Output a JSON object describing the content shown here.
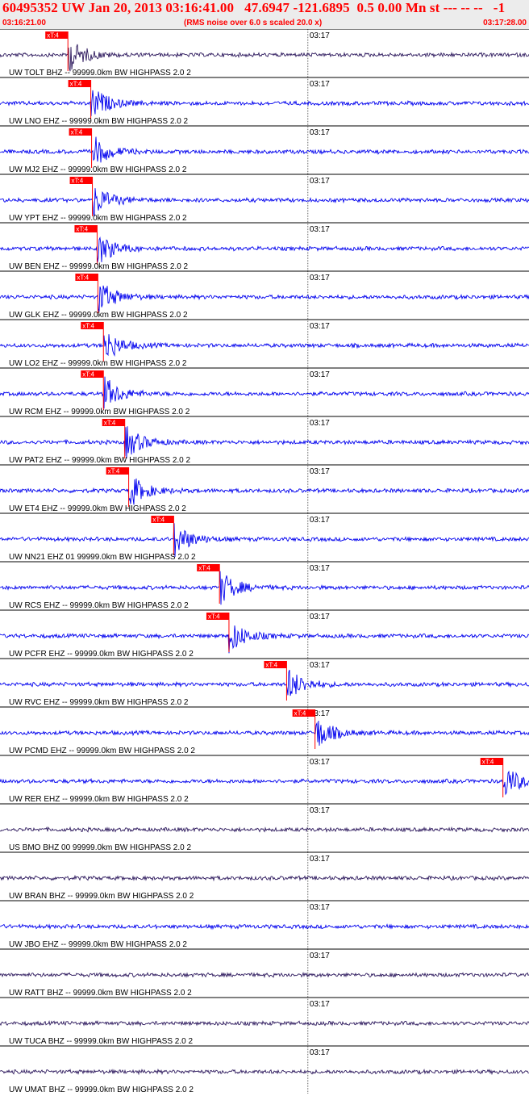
{
  "header": {
    "title": "60495352 UW Jan 20, 2013 03:16:41.00   47.6947 -121.6895  0.5 0.00 Mn st --- -- --   -1",
    "start_time": "03:16:21.00",
    "rms_note": "(RMS noise over 6.0 s scaled 20.0 x)",
    "end_time": "03:17:28.00"
  },
  "colors": {
    "header_text": "#ff0000",
    "header_bg": "#ececec",
    "trace_blue": "#0000ee",
    "trace_dark": "#2e1a5e",
    "pick_box": "#ff0000",
    "pick_text": "#ffffff",
    "label_text": "#000000"
  },
  "chart_data": {
    "type": "line",
    "time_axis": {
      "start": "03:16:21.00",
      "end": "03:17:28.00",
      "minute_mark": "03:17"
    },
    "pick_label": "xT:4",
    "traces": [
      {
        "label": "UW TOLT BHZ -- 99999.0km BW  HIGHPASS  2.0  2",
        "color": "dark",
        "pick": true,
        "pick_time": "03:16:29.6"
      },
      {
        "label": "UW LNO EHZ -- 99999.0km BW  HIGHPASS  2.0  2",
        "color": "blue",
        "pick": true,
        "pick_time": "03:16:32.5"
      },
      {
        "label": "UW MJ2 EHZ -- 99999.0km BW  HIGHPASS  2.0  2",
        "color": "blue",
        "pick": true,
        "pick_time": "03:16:32.6"
      },
      {
        "label": "UW YPT EHZ -- 99999.0km BW  HIGHPASS  2.0  2",
        "color": "blue",
        "pick": true,
        "pick_time": "03:16:32.7"
      },
      {
        "label": "UW BEN EHZ -- 99999.0km BW  HIGHPASS  2.0  2",
        "color": "blue",
        "pick": true,
        "pick_time": "03:16:33.3"
      },
      {
        "label": "UW GLK EHZ -- 99999.0km BW  HIGHPASS  2.0  2",
        "color": "blue",
        "pick": true,
        "pick_time": "03:16:33.4"
      },
      {
        "label": "UW LO2 EHZ -- 99999.0km BW  HIGHPASS  2.0  2",
        "color": "blue",
        "pick": true,
        "pick_time": "03:16:34.1"
      },
      {
        "label": "UW RCM EHZ -- 99999.0km BW  HIGHPASS  2.0  2",
        "color": "blue",
        "pick": true,
        "pick_time": "03:16:34.1"
      },
      {
        "label": "UW PAT2 EHZ -- 99999.0km BW  HIGHPASS  2.0  2",
        "color": "blue",
        "pick": true,
        "pick_time": "03:16:36.8"
      },
      {
        "label": "UW ET4 EHZ -- 99999.0km BW  HIGHPASS  2.0  2",
        "color": "blue",
        "pick": true,
        "pick_time": "03:16:37.3"
      },
      {
        "label": "UW NN21 EHZ 01 99999.0km BW  HIGHPASS  2.0  2",
        "color": "blue",
        "pick": true,
        "pick_time": "03:16:43.0"
      },
      {
        "label": "UW RCS EHZ -- 99999.0km BW  HIGHPASS  2.0  2",
        "color": "blue",
        "pick": true,
        "pick_time": "03:16:48.8"
      },
      {
        "label": "UW PCFR EHZ -- 99999.0km BW  HIGHPASS  2.0  2",
        "color": "blue",
        "pick": true,
        "pick_time": "03:16:50.0"
      },
      {
        "label": "UW RVC EHZ -- 99999.0km BW  HIGHPASS  2.0  2",
        "color": "blue",
        "pick": true,
        "pick_time": "03:16:57.3"
      },
      {
        "label": "UW PCMD EHZ -- 99999.0km BW  HIGHPASS  2.0  2",
        "color": "blue",
        "pick": true,
        "pick_time": "03:17:00.9"
      },
      {
        "label": "UW RER EHZ -- 99999.0km BW  HIGHPASS  2.0  2",
        "color": "blue",
        "pick": true,
        "pick_time": "03:17:24.7"
      },
      {
        "label": "US BMO BHZ 00 99999.0km BW  HIGHPASS  2.0  2",
        "color": "dark",
        "pick": false
      },
      {
        "label": "UW BRAN BHZ -- 99999.0km BW  HIGHPASS  2.0  2",
        "color": "dark",
        "pick": false
      },
      {
        "label": "UW JBO EHZ -- 99999.0km BW  HIGHPASS  2.0  2",
        "color": "blue",
        "pick": false
      },
      {
        "label": "UW RATT BHZ -- 99999.0km BW  HIGHPASS  2.0  2",
        "color": "dark",
        "pick": false
      },
      {
        "label": "UW TUCA BHZ -- 99999.0km BW  HIGHPASS  2.0  2",
        "color": "dark",
        "pick": false
      },
      {
        "label": "UW UMAT BHZ -- 99999.0km BW  HIGHPASS  2.0  2",
        "color": "dark",
        "pick": false
      }
    ]
  }
}
